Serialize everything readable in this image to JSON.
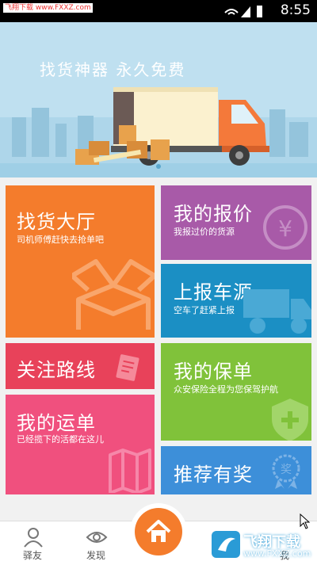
{
  "status_bar": {
    "watermark": "飞翔下载 www.FXXZ.com",
    "time": "8:55"
  },
  "banner": {
    "slogan": "找货神器  永久免费"
  },
  "tiles": {
    "find_cargo": {
      "title": "找货大厅",
      "subtitle": "司机师傅赶快去抢单吧"
    },
    "my_quote": {
      "title": "我的报价",
      "subtitle": "我报过价的货源"
    },
    "report_vehicle": {
      "title": "上报车源",
      "subtitle": "空车了赶紧上报"
    },
    "follow_route": {
      "title": "关注路线"
    },
    "my_policy": {
      "title": "我的保单",
      "subtitle": "众安保险全程为您保驾护航"
    },
    "my_waybill": {
      "title": "我的运单",
      "subtitle": "已经揽下的活都在这儿"
    },
    "referral": {
      "title": "推荐有奖"
    }
  },
  "tabbar": {
    "items": [
      {
        "label": "驿友",
        "icon": "person-icon"
      },
      {
        "label": "发现",
        "icon": "eye-icon"
      },
      {
        "label": "",
        "icon": "home-icon"
      },
      {
        "label": "我",
        "icon": "me-icon"
      }
    ]
  },
  "watermark": {
    "line1": "飞翔下载",
    "line2": "www.FXXZ.com"
  },
  "colors": {
    "orange": "#f47c2c",
    "purple": "#a85aa8",
    "blue": "#1b8fc4",
    "red": "#e8425a",
    "green": "#80c23a",
    "pink": "#f0507e",
    "lightblue": "#3d8fd9",
    "sky": "#bfe0f0"
  }
}
